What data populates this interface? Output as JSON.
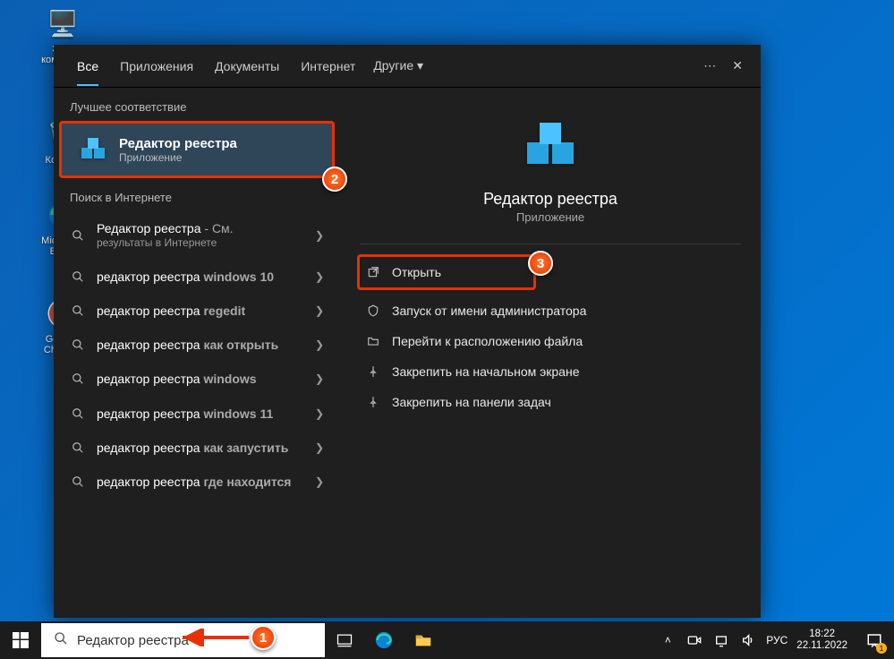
{
  "desktop": {
    "pc": "Этот компью...",
    "trash": "Корзи...",
    "edge": "Microso... Edg...",
    "chrome": "Googl... Chrom..."
  },
  "panel": {
    "tabs": [
      "Все",
      "Приложения",
      "Документы",
      "Интернет",
      "Другие"
    ],
    "sections": {
      "best": "Лучшее соответствие",
      "web": "Поиск в Интернете"
    },
    "bestMatch": {
      "title": "Редактор реестра",
      "sub": "Приложение"
    },
    "webItems": [
      {
        "q": "Редактор реестра",
        "hint": " - См.",
        "sub": "результаты в Интернете"
      },
      {
        "q": "редактор реестра ",
        "hint": "windows 10"
      },
      {
        "q": "редактор реестра ",
        "hint": "regedit"
      },
      {
        "q": "редактор реестра ",
        "hint": "как открыть"
      },
      {
        "q": "редактор реестра ",
        "hint": "windows"
      },
      {
        "q": "редактор реестра ",
        "hint": "windows 11"
      },
      {
        "q": "редактор реестра ",
        "hint": "как запустить"
      },
      {
        "q": "редактор реестра ",
        "hint": "где находится"
      }
    ],
    "detail": {
      "title": "Редактор реестра",
      "sub": "Приложение",
      "actions": [
        "Открыть",
        "Запуск от имени администратора",
        "Перейти к расположению файла",
        "Закрепить на начальном экране",
        "Закрепить на панели задач"
      ]
    }
  },
  "taskbar": {
    "search": "Редактор реестра",
    "lang": "РУС",
    "time": "18:22",
    "date": "22.11.2022",
    "notif_count": "1"
  },
  "markers": {
    "m1": "1",
    "m2": "2",
    "m3": "3"
  }
}
